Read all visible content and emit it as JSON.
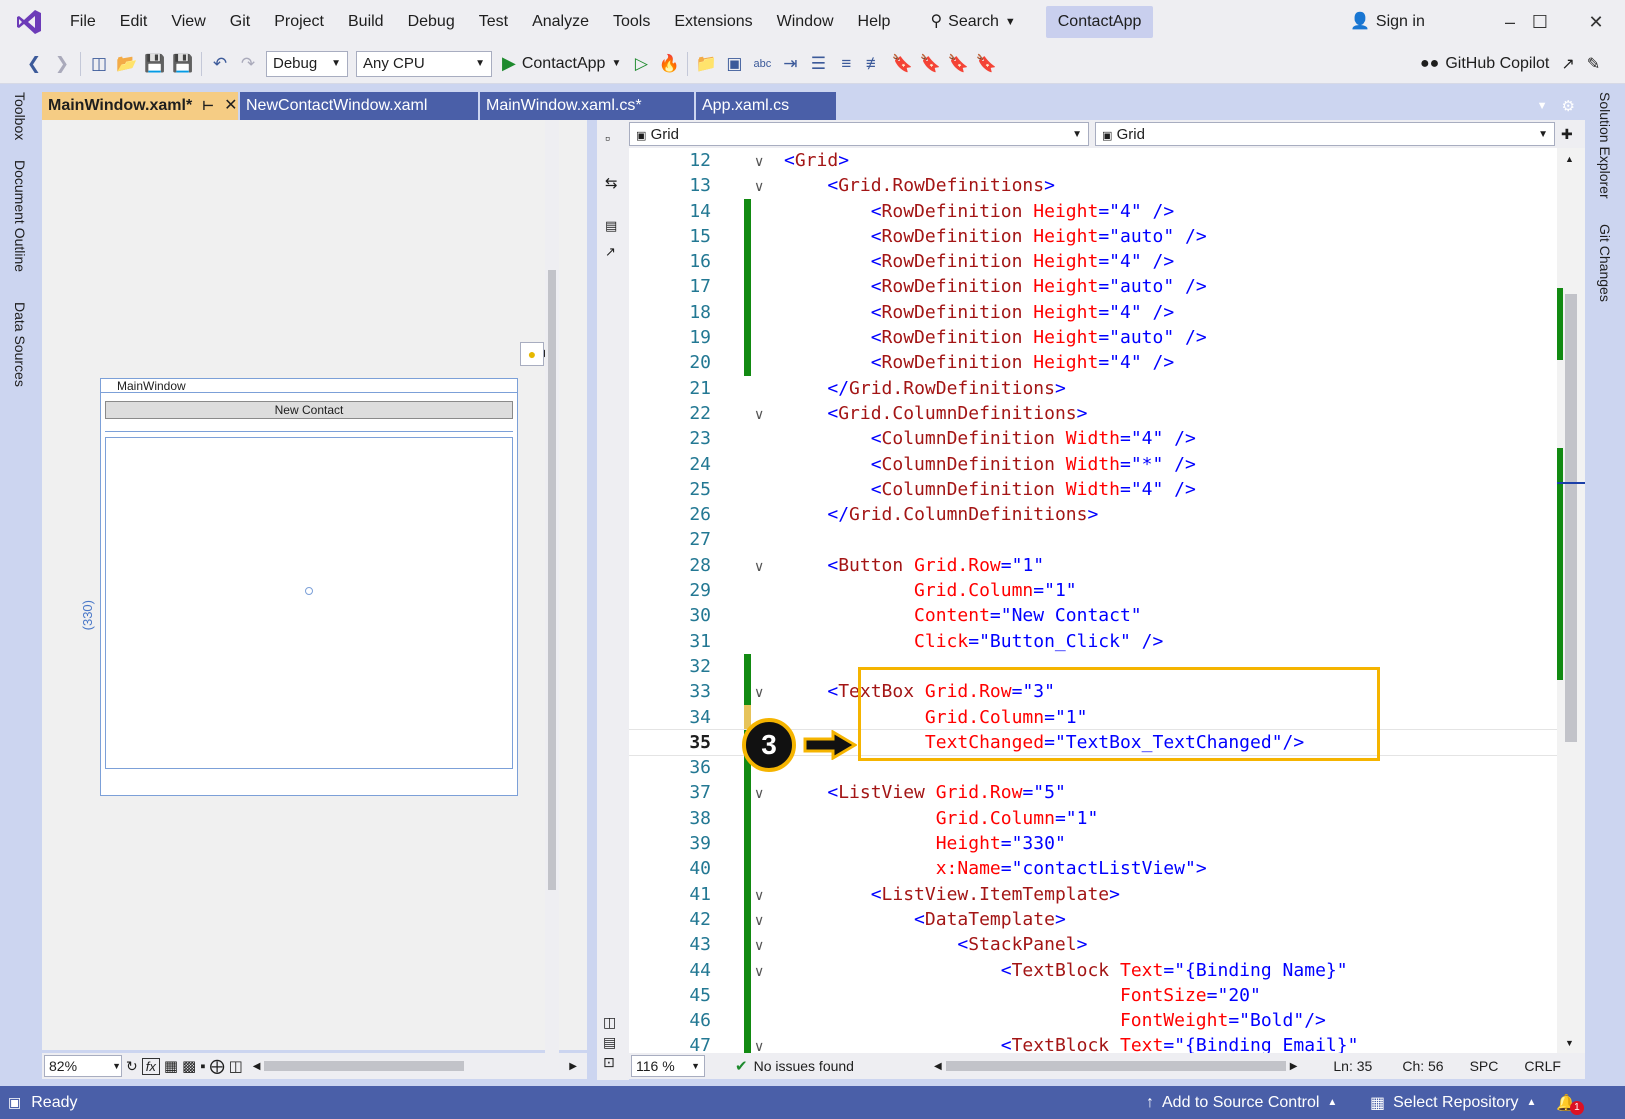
{
  "menubar": {
    "items": [
      "File",
      "Edit",
      "View",
      "Git",
      "Project",
      "Build",
      "Debug",
      "Test",
      "Analyze",
      "Tools",
      "Extensions",
      "Window",
      "Help"
    ],
    "search_label": "Search",
    "app_name": "ContactApp",
    "signin_label": "Sign in"
  },
  "toolbar": {
    "config": "Debug",
    "platform": "Any CPU",
    "run_label": "ContactApp",
    "copilot_label": "GitHub Copilot"
  },
  "left_strip": {
    "tabs": [
      "Toolbox",
      "Document Outline",
      "Data Sources"
    ]
  },
  "right_strip": {
    "tabs": [
      "Solution Explorer",
      "Git Changes"
    ]
  },
  "doc_tabs": [
    {
      "label": "MainWindow.xaml*",
      "active": true
    },
    {
      "label": "NewContactWindow.xaml",
      "active": false
    },
    {
      "label": "MainWindow.xaml.cs*",
      "active": false
    },
    {
      "label": "App.xaml.cs",
      "active": false
    }
  ],
  "designer": {
    "window_title": "MainWindow",
    "button_label": "New Contact",
    "height_label": "(330)",
    "zoom": "82%"
  },
  "nav_bar": {
    "left": "Grid",
    "right": "Grid"
  },
  "editor": {
    "zoom": "116 %",
    "issues": "No issues found",
    "ln": "Ln: 35",
    "ch": "Ch: 56",
    "spc": "SPC",
    "crlf": "CRLF",
    "current_line": 35,
    "lines": [
      {
        "n": "12",
        "code": "<Grid>"
      },
      {
        "n": "13",
        "code": "    <Grid.RowDefinitions>"
      },
      {
        "n": "14",
        "code": "        <RowDefinition Height=\"4\" />"
      },
      {
        "n": "15",
        "code": "        <RowDefinition Height=\"auto\" />"
      },
      {
        "n": "16",
        "code": "        <RowDefinition Height=\"4\" />"
      },
      {
        "n": "17",
        "code": "        <RowDefinition Height=\"auto\" />"
      },
      {
        "n": "18",
        "code": "        <RowDefinition Height=\"4\" />"
      },
      {
        "n": "19",
        "code": "        <RowDefinition Height=\"auto\" />"
      },
      {
        "n": "20",
        "code": "        <RowDefinition Height=\"4\" />"
      },
      {
        "n": "21",
        "code": "    </Grid.RowDefinitions>"
      },
      {
        "n": "22",
        "code": "    <Grid.ColumnDefinitions>"
      },
      {
        "n": "23",
        "code": "        <ColumnDefinition Width=\"4\" />"
      },
      {
        "n": "24",
        "code": "        <ColumnDefinition Width=\"*\" />"
      },
      {
        "n": "25",
        "code": "        <ColumnDefinition Width=\"4\" />"
      },
      {
        "n": "26",
        "code": "    </Grid.ColumnDefinitions>"
      },
      {
        "n": "27",
        "code": ""
      },
      {
        "n": "28",
        "code": "    <Button Grid.Row=\"1\""
      },
      {
        "n": "29",
        "code": "            Grid.Column=\"1\""
      },
      {
        "n": "30",
        "code": "            Content=\"New Contact\""
      },
      {
        "n": "31",
        "code": "            Click=\"Button_Click\" />"
      },
      {
        "n": "32",
        "code": ""
      },
      {
        "n": "33",
        "code": "    <TextBox Grid.Row=\"3\""
      },
      {
        "n": "34",
        "code": "             Grid.Column=\"1\""
      },
      {
        "n": "35",
        "code": "             TextChanged=\"TextBox_TextChanged\"/>"
      },
      {
        "n": "36",
        "code": ""
      },
      {
        "n": "37",
        "code": "    <ListView Grid.Row=\"5\""
      },
      {
        "n": "38",
        "code": "              Grid.Column=\"1\""
      },
      {
        "n": "39",
        "code": "              Height=\"330\""
      },
      {
        "n": "40",
        "code": "              x:Name=\"contactListView\">"
      },
      {
        "n": "41",
        "code": "        <ListView.ItemTemplate>"
      },
      {
        "n": "42",
        "code": "            <DataTemplate>"
      },
      {
        "n": "43",
        "code": "                <StackPanel>"
      },
      {
        "n": "44",
        "code": "                    <TextBlock Text=\"{Binding Name}\""
      },
      {
        "n": "45",
        "code": "                               FontSize=\"20\""
      },
      {
        "n": "46",
        "code": "                               FontWeight=\"Bold\"/>"
      },
      {
        "n": "47",
        "code": "                    <TextBlock Text=\"{Binding Email}\""
      }
    ]
  },
  "callout": {
    "number": "3"
  },
  "statusbar": {
    "ready": "Ready",
    "add_source": "Add to Source Control",
    "select_repo": "Select Repository",
    "notif_count": "1"
  },
  "colors": {
    "accent": "#4a5fa8",
    "highlight": "#f5b400",
    "active_tab": "#f5cc84"
  }
}
